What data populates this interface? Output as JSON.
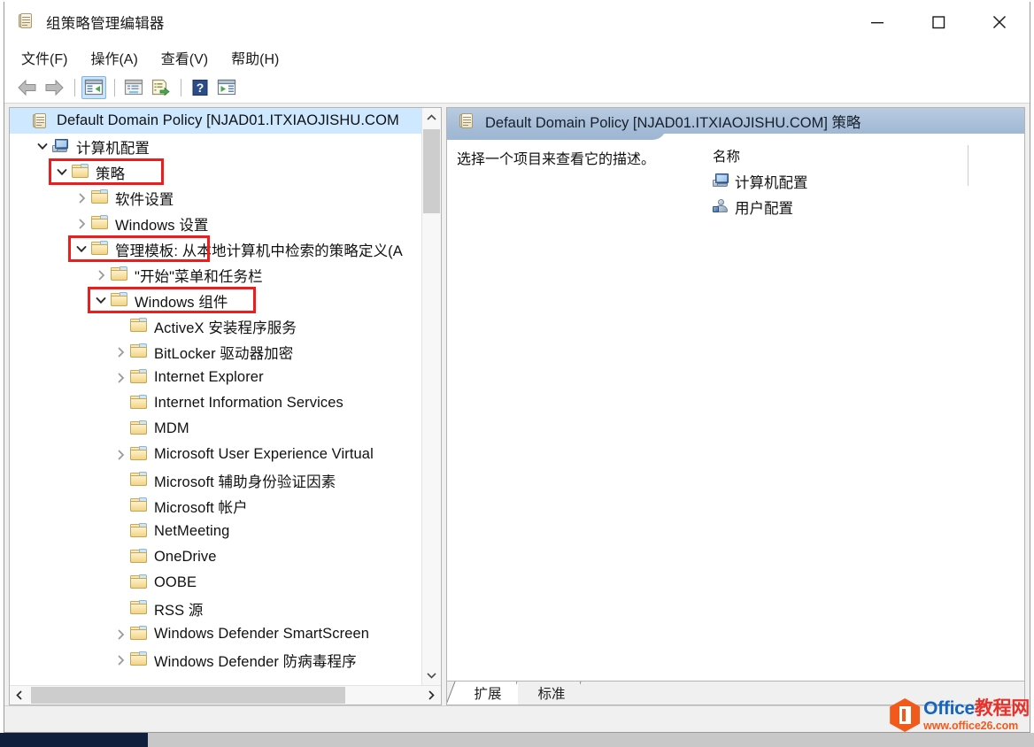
{
  "window": {
    "title": "组策略管理编辑器",
    "title_icon": "policy-scroll-icon",
    "controls": {
      "minimize": "minimize-icon",
      "maximize": "maximize-icon",
      "close": "close-icon"
    }
  },
  "menubar": {
    "items": [
      {
        "label": "文件(F)",
        "name": "menu-file"
      },
      {
        "label": "操作(A)",
        "name": "menu-action"
      },
      {
        "label": "查看(V)",
        "name": "menu-view"
      },
      {
        "label": "帮助(H)",
        "name": "menu-help"
      }
    ]
  },
  "toolbar": {
    "buttons": [
      {
        "name": "back-button",
        "icon": "back-arrow-icon",
        "pressed": false
      },
      {
        "name": "forward-button",
        "icon": "forward-arrow-icon",
        "pressed": false
      },
      {
        "name": "show-hide-tree-button",
        "icon": "console-tree-icon",
        "pressed": true
      },
      {
        "name": "properties-button",
        "icon": "properties-window-icon",
        "pressed": false
      },
      {
        "name": "export-list-button",
        "icon": "export-list-icon",
        "pressed": false
      },
      {
        "name": "help-button",
        "icon": "question-mark-icon",
        "pressed": false
      },
      {
        "name": "show-action-pane-button",
        "icon": "action-pane-icon",
        "pressed": false
      }
    ]
  },
  "tree": {
    "nodes": [
      {
        "label": "Default Domain Policy [NJAD01.ITXIAOJISHU.COM",
        "indent": 0,
        "icon": "policy-scroll-icon",
        "twisty": "none",
        "selected": true,
        "annotated": false
      },
      {
        "label": "计算机配置",
        "indent": 1,
        "icon": "computer-icon",
        "twisty": "expanded",
        "selected": false,
        "annotated": false
      },
      {
        "label": "策略",
        "indent": 2,
        "icon": "folder-icon",
        "twisty": "expanded",
        "selected": false,
        "annotated": true
      },
      {
        "label": "软件设置",
        "indent": 3,
        "icon": "folder-icon",
        "twisty": "collapsed",
        "selected": false,
        "annotated": false
      },
      {
        "label": "Windows 设置",
        "indent": 3,
        "icon": "folder-icon",
        "twisty": "collapsed",
        "selected": false,
        "annotated": false
      },
      {
        "label": "管理模板: 从本地计算机中检索的策略定义(A",
        "indent": 3,
        "icon": "folder-icon",
        "twisty": "expanded",
        "selected": false,
        "annotated": true
      },
      {
        "label": "\"开始\"菜单和任务栏",
        "indent": 4,
        "icon": "folder-icon",
        "twisty": "collapsed",
        "selected": false,
        "annotated": false
      },
      {
        "label": "Windows 组件",
        "indent": 4,
        "icon": "folder-icon",
        "twisty": "expanded",
        "selected": false,
        "annotated": true
      },
      {
        "label": "ActiveX 安装程序服务",
        "indent": 5,
        "icon": "folder-icon",
        "twisty": "none",
        "selected": false,
        "annotated": false
      },
      {
        "label": "BitLocker 驱动器加密",
        "indent": 5,
        "icon": "folder-icon",
        "twisty": "collapsed",
        "selected": false,
        "annotated": false
      },
      {
        "label": "Internet Explorer",
        "indent": 5,
        "icon": "folder-icon",
        "twisty": "collapsed",
        "selected": false,
        "annotated": false
      },
      {
        "label": "Internet Information Services",
        "indent": 5,
        "icon": "folder-icon",
        "twisty": "none",
        "selected": false,
        "annotated": false
      },
      {
        "label": "MDM",
        "indent": 5,
        "icon": "folder-icon",
        "twisty": "none",
        "selected": false,
        "annotated": false
      },
      {
        "label": "Microsoft User Experience Virtual",
        "indent": 5,
        "icon": "folder-icon",
        "twisty": "collapsed",
        "selected": false,
        "annotated": false
      },
      {
        "label": "Microsoft 辅助身份验证因素",
        "indent": 5,
        "icon": "folder-icon",
        "twisty": "none",
        "selected": false,
        "annotated": false
      },
      {
        "label": "Microsoft 帐户",
        "indent": 5,
        "icon": "folder-icon",
        "twisty": "none",
        "selected": false,
        "annotated": false
      },
      {
        "label": "NetMeeting",
        "indent": 5,
        "icon": "folder-icon",
        "twisty": "none",
        "selected": false,
        "annotated": false
      },
      {
        "label": "OneDrive",
        "indent": 5,
        "icon": "folder-icon",
        "twisty": "none",
        "selected": false,
        "annotated": false
      },
      {
        "label": "OOBE",
        "indent": 5,
        "icon": "folder-icon",
        "twisty": "none",
        "selected": false,
        "annotated": false
      },
      {
        "label": "RSS 源",
        "indent": 5,
        "icon": "folder-icon",
        "twisty": "none",
        "selected": false,
        "annotated": false
      },
      {
        "label": "Windows Defender SmartScreen",
        "indent": 5,
        "icon": "folder-icon",
        "twisty": "collapsed",
        "selected": false,
        "annotated": false
      },
      {
        "label": "Windows Defender 防病毒程序",
        "indent": 5,
        "icon": "folder-icon",
        "twisty": "collapsed",
        "selected": false,
        "annotated": false
      }
    ]
  },
  "details": {
    "header_title": "Default Domain Policy [NJAD01.ITXIAOJISHU.COM] 策略",
    "header_icon": "policy-scroll-icon",
    "description": "选择一个项目来查看它的描述。",
    "column_header": "名称",
    "items": [
      {
        "label": "计算机配置",
        "icon": "computer-icon"
      },
      {
        "label": "用户配置",
        "icon": "user-icon"
      }
    ]
  },
  "tabs": [
    {
      "label": "扩展",
      "active": true,
      "name": "tab-extended"
    },
    {
      "label": "标准",
      "active": false,
      "name": "tab-standard"
    }
  ],
  "watermark": {
    "brand_en": "Office",
    "brand_cn": "教程网",
    "url": "www.office26.com"
  },
  "colors": {
    "annotation_red": "#ee1c1c",
    "selection_blue": "#cde8ff",
    "header_blue": "#a0b8d4",
    "watermark_blue": "#1565c0",
    "watermark_orange": "#f25a1c"
  }
}
